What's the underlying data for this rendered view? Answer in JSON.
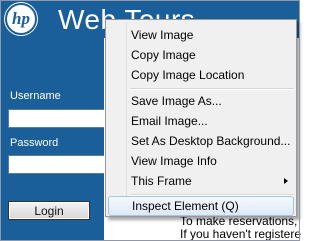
{
  "header": {
    "logo": "hp",
    "title": "Web Tours"
  },
  "login": {
    "username_label": "Username",
    "password_label": "Password",
    "username_value": "",
    "password_value": "",
    "login_button": "Login"
  },
  "main": {
    "lines": [
      "To make reservations,",
      "If you haven't registere"
    ]
  },
  "context_menu": {
    "items": [
      {
        "label": "View Image"
      },
      {
        "label": "Copy Image"
      },
      {
        "label": "Copy Image Location"
      },
      {
        "label": "Save Image As..."
      },
      {
        "label": "Email Image..."
      },
      {
        "label": "Set As Desktop Background..."
      },
      {
        "label": "View Image Info"
      },
      {
        "label": "This Frame"
      },
      {
        "label": "Inspect Element (Q)"
      }
    ],
    "highlighted": "Inspect Element (Q)"
  },
  "colors": {
    "brand_blue": "#1a5f9a",
    "menu_bg": "#f0f0f0",
    "highlight_border": "#a9c3e2"
  }
}
